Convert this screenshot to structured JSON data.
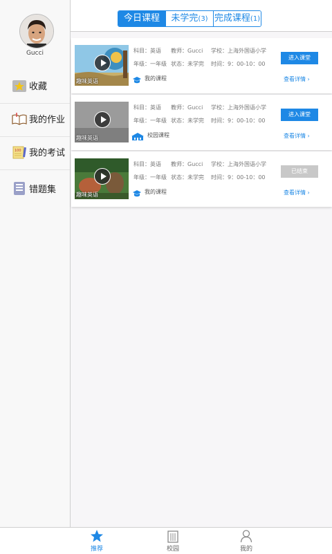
{
  "user": {
    "name": "Gucci"
  },
  "sidebar": {
    "items": [
      {
        "label": "收藏",
        "icon": "star-folder-icon"
      },
      {
        "label": "我的作业",
        "icon": "open-book-icon"
      },
      {
        "label": "我的考试",
        "icon": "exam-paper-icon"
      },
      {
        "label": "错题集",
        "icon": "notebook-icon"
      }
    ]
  },
  "tabs": [
    {
      "label": "今日课程",
      "count": ""
    },
    {
      "label": "未学完",
      "count": "(3)"
    },
    {
      "label": "完成课程",
      "count": "(1)"
    }
  ],
  "courses": [
    {
      "thumb_label": "趣味英语",
      "subject": "科目：英语",
      "teacher": "教师：Gucci",
      "school": "学校：上海外国语小学",
      "grade": "年级：一年级",
      "status": "状态：未学完",
      "time": "时间：9：00-10：00",
      "source": "我的课程",
      "action": "进入课堂",
      "detail": "查看详情",
      "chevron": "›"
    },
    {
      "thumb_label": "趣味英语",
      "subject": "科目：英语",
      "teacher": "教师：Gucci",
      "school": "学校：上海外国语小学",
      "grade": "年级：一年级",
      "status": "状态：未学完",
      "time": "时间：9：00-10：00",
      "source": "校园课程",
      "action": "进入课堂",
      "detail": "查看详情",
      "chevron": "›"
    },
    {
      "thumb_label": "趣味英语",
      "subject": "科目：英语",
      "teacher": "教师：Gucci",
      "school": "学校：上海外国语小学",
      "grade": "年级：一年级",
      "status": "状态：未学完",
      "time": "时间：9：00-10：00",
      "source": "我的课程",
      "action": "已结束",
      "detail": "查看详情",
      "chevron": "›"
    }
  ],
  "bottom_nav": [
    {
      "label": "推荐",
      "icon": "star-icon"
    },
    {
      "label": "校园",
      "icon": "building-icon"
    },
    {
      "label": "我的",
      "icon": "person-icon"
    }
  ],
  "colors": {
    "accent": "#1e88e5",
    "ended": "#c8c8c8"
  }
}
